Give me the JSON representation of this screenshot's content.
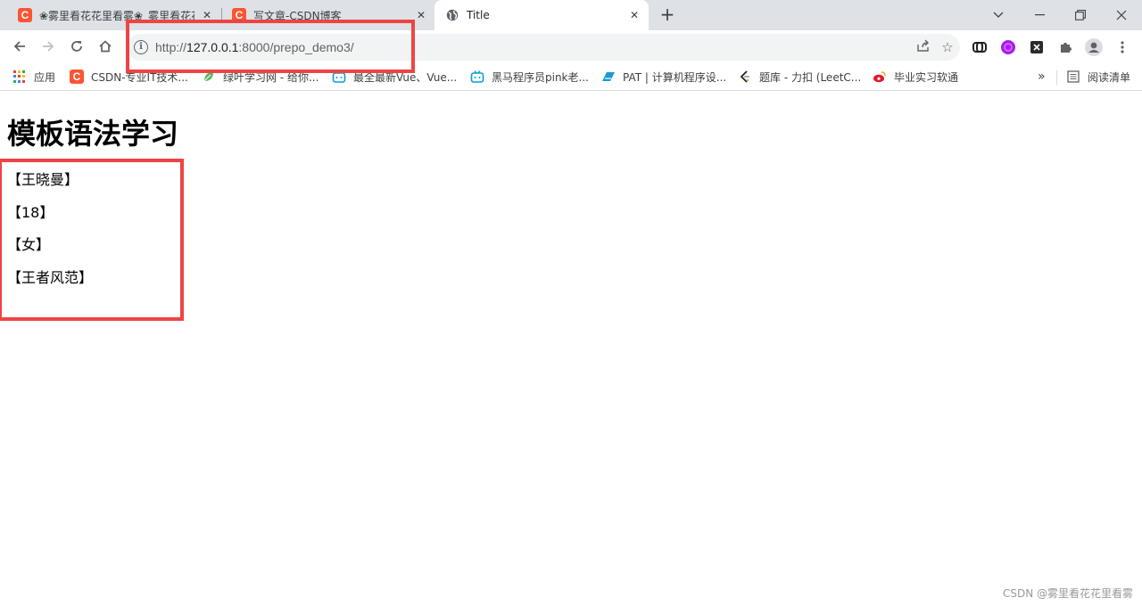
{
  "browser": {
    "tabs": [
      {
        "title": "❀雾里看花花里看雾❀_雾里看花花里看雾",
        "favicon": "csdn-icon",
        "active": false
      },
      {
        "title": "写文章-CSDN博客",
        "favicon": "csdn-icon",
        "active": false
      },
      {
        "title": "Title",
        "favicon": "globe-icon",
        "active": true
      }
    ],
    "address": {
      "scheme": "http://",
      "host": "127.0.0.1",
      "path": ":8000/prepo_demo3/"
    },
    "bookmarks": [
      {
        "label": "应用",
        "icon": "apps-grid-icon"
      },
      {
        "label": "CSDN-专业IT技术...",
        "icon": "csdn-icon"
      },
      {
        "label": "绿叶学习网 - 给你...",
        "icon": "leaf-icon"
      },
      {
        "label": "最全最新Vue、Vue...",
        "icon": "bilibili-icon"
      },
      {
        "label": "黑马程序员pink老...",
        "icon": "bilibili-icon"
      },
      {
        "label": "PAT | 计算机程序设...",
        "icon": "pat-icon"
      },
      {
        "label": "题库 - 力扣 (LeetC...",
        "icon": "leetcode-icon"
      },
      {
        "label": "毕业实习软通",
        "icon": "weibo-icon"
      }
    ],
    "overflow_label": "»",
    "reading_list": "阅读清单"
  },
  "page": {
    "heading": "模板语法学习",
    "items": [
      "【王晓曼】",
      "【18】",
      "【女】",
      "【王者风范】"
    ]
  },
  "watermark": "CSDN @雾里看花花里看雾",
  "colors": {
    "highlight": "#ef4444",
    "csdn": "#fc5531",
    "tabstrip": "#dee1e6"
  }
}
